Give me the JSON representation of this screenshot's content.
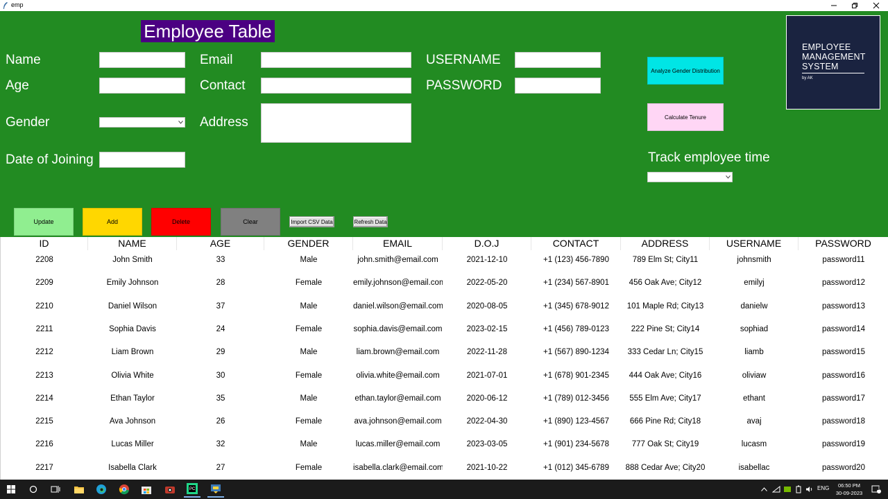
{
  "window": {
    "title": "emp"
  },
  "form": {
    "heading": "Employee Table",
    "labels": {
      "name": "Name",
      "age": "Age",
      "gender": "Gender",
      "date_of_joining": "Date of Joining",
      "email": "Email",
      "contact": "Contact",
      "address": "Address",
      "username": "USERNAME",
      "password": "PASSWORD",
      "track_time": "Track employee time"
    },
    "values": {
      "name": "",
      "age": "",
      "gender": "",
      "date_of_joining": "",
      "email": "",
      "contact": "",
      "address": "",
      "username": "",
      "password": "",
      "track_time": ""
    }
  },
  "buttons": {
    "analyze_gender": "Analyze Gender Distribution",
    "calculate_tenure": "Calculate Tenure",
    "update": "Update",
    "add": "Add",
    "delete": "Delete",
    "clear": "Clear",
    "import_csv": "Import CSV Data",
    "refresh": "Refresh Data"
  },
  "logo": {
    "line1": "EMPLOYEE",
    "line2": "MANAGEMENT",
    "line3": "SYSTEM",
    "byline": "by AK"
  },
  "table": {
    "columns": [
      "ID",
      "NAME",
      "AGE",
      "GENDER",
      "EMAIL",
      "D.O.J",
      "CONTACT",
      "ADDRESS",
      "USERNAME",
      "PASSWORD"
    ],
    "rows": [
      [
        "2208",
        "John Smith",
        "33",
        "Male",
        "john.smith@email.com",
        "2021-12-10",
        "+1 (123) 456-7890",
        "789 Elm St; City11",
        "johnsmith",
        "password11"
      ],
      [
        "2209",
        "Emily Johnson",
        "28",
        "Female",
        "emily.johnson@email.com",
        "2022-05-20",
        "+1 (234) 567-8901",
        "456 Oak Ave; City12",
        "emilyj",
        "password12"
      ],
      [
        "2210",
        "Daniel Wilson",
        "37",
        "Male",
        "daniel.wilson@email.com",
        "2020-08-05",
        "+1 (345) 678-9012",
        "101 Maple Rd; City13",
        "danielw",
        "password13"
      ],
      [
        "2211",
        "Sophia Davis",
        "24",
        "Female",
        "sophia.davis@email.com",
        "2023-02-15",
        "+1 (456) 789-0123",
        "222 Pine St; City14",
        "sophiad",
        "password14"
      ],
      [
        "2212",
        "Liam Brown",
        "29",
        "Male",
        "liam.brown@email.com",
        "2022-11-28",
        "+1 (567) 890-1234",
        "333 Cedar Ln; City15",
        "liamb",
        "password15"
      ],
      [
        "2213",
        "Olivia White",
        "30",
        "Female",
        "olivia.white@email.com",
        "2021-07-01",
        "+1 (678) 901-2345",
        "444 Oak Ave; City16",
        "oliviaw",
        "password16"
      ],
      [
        "2214",
        "Ethan Taylor",
        "35",
        "Male",
        "ethan.taylor@email.com",
        "2020-06-12",
        "+1 (789) 012-3456",
        "555 Elm Ave; City17",
        "ethant",
        "password17"
      ],
      [
        "2215",
        "Ava Johnson",
        "26",
        "Female",
        "ava.johnson@email.com",
        "2022-04-30",
        "+1 (890) 123-4567",
        "666 Pine Rd; City18",
        "avaj",
        "password18"
      ],
      [
        "2216",
        "Lucas Miller",
        "32",
        "Male",
        "lucas.miller@email.com",
        "2023-03-05",
        "+1 (901) 234-5678",
        "777 Oak St; City19",
        "lucasm",
        "password19"
      ],
      [
        "2217",
        "Isabella Clark",
        "27",
        "Female",
        "isabella.clark@email.com",
        "2021-10-22",
        "+1 (012) 345-6789",
        "888 Cedar Ave; City20",
        "isabellac",
        "password20"
      ]
    ]
  },
  "taskbar": {
    "icons": [
      "windows-start-icon",
      "search-icon",
      "task-view-icon",
      "file-explorer-icon",
      "edge-icon",
      "chrome-icon",
      "store-icon",
      "camera-app-icon",
      "pycharm-icon",
      "python-app-icon"
    ],
    "language": "ENG",
    "time": "06:50 PM",
    "date": "30-09-2023",
    "notifications": "2"
  },
  "colors": {
    "form_bg": "#228b22",
    "title_bg": "#4b0082",
    "analyze_btn": "#00e5e5",
    "tenure_btn": "#ffd6f5",
    "update_btn": "#90ee90",
    "add_btn": "#ffd700",
    "delete_btn": "#ff0000",
    "clear_btn": "#808080",
    "logo_bg": "#1a2340",
    "taskbar_bg": "#1b1b1b"
  }
}
